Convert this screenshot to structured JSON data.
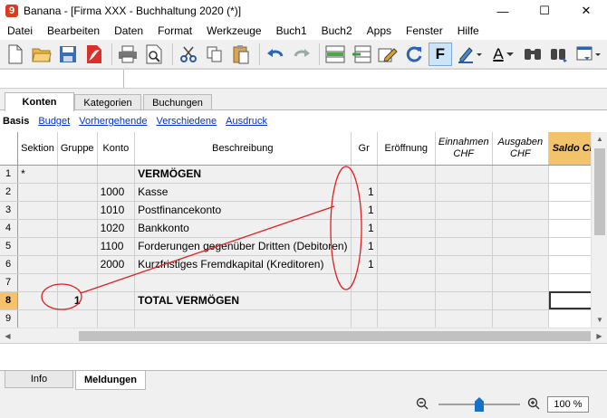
{
  "window": {
    "title": "Banana - [Firma XXX - Buchhaltung 2020 (*)]",
    "logo_text": "9",
    "minimize": "—",
    "maximize": "☐",
    "close": "✕"
  },
  "menu": [
    "Datei",
    "Bearbeiten",
    "Daten",
    "Format",
    "Werkzeuge",
    "Buch1",
    "Buch2",
    "Apps",
    "Fenster",
    "Hilfe"
  ],
  "toolbar": {
    "bold_label": "F",
    "font_color_label": "A"
  },
  "tabs": [
    "Konten",
    "Kategorien",
    "Buchungen"
  ],
  "active_tab": "Konten",
  "views": {
    "current": "Basis",
    "links": [
      "Budget",
      "Vorhergehende",
      "Verschiedene",
      "Ausdruck"
    ]
  },
  "table": {
    "headers": {
      "sektion": "Sektion",
      "gruppe": "Gruppe",
      "konto": "Konto",
      "beschreibung": "Beschreibung",
      "gr": "Gr",
      "eroeffnung": "Eröffnung",
      "einnahmen": "Einnahmen CHF",
      "ausgaben": "Ausgaben CHF",
      "saldo": "Saldo CHF"
    },
    "rows": [
      {
        "n": "1",
        "sektion": "*",
        "gruppe": "",
        "konto": "",
        "beschreibung": "VERMÖGEN",
        "gr": "",
        "bold": true
      },
      {
        "n": "2",
        "sektion": "",
        "gruppe": "",
        "konto": "1000",
        "beschreibung": "Kasse",
        "gr": "1",
        "bold": false
      },
      {
        "n": "3",
        "sektion": "",
        "gruppe": "",
        "konto": "1010",
        "beschreibung": "Postfinancekonto",
        "gr": "1",
        "bold": false
      },
      {
        "n": "4",
        "sektion": "",
        "gruppe": "",
        "konto": "1020",
        "beschreibung": "Bankkonto",
        "gr": "1",
        "bold": false
      },
      {
        "n": "5",
        "sektion": "",
        "gruppe": "",
        "konto": "1100",
        "beschreibung": "Forderungen gegenüber Dritten (Debitoren)",
        "gr": "1",
        "bold": false
      },
      {
        "n": "6",
        "sektion": "",
        "gruppe": "",
        "konto": "2000",
        "beschreibung": "Kurzfristiges Fremdkapital (Kreditoren)",
        "gr": "1",
        "bold": false
      },
      {
        "n": "7",
        "sektion": "",
        "gruppe": "",
        "konto": "",
        "beschreibung": "",
        "gr": "",
        "bold": false
      },
      {
        "n": "8",
        "sektion": "",
        "gruppe": "1",
        "konto": "",
        "beschreibung": "TOTAL VERMÖGEN",
        "gr": "",
        "bold": true
      },
      {
        "n": "9",
        "sektion": "",
        "gruppe": "",
        "konto": "",
        "beschreibung": "",
        "gr": "",
        "bold": false
      }
    ],
    "selected_row": "8"
  },
  "bottom_tabs": [
    "Info",
    "Meldungen"
  ],
  "active_bottom_tab": "Meldungen",
  "zoom": {
    "value": "100 %",
    "level_fraction": 0.5
  },
  "colors": {
    "saldo_header": "#f2c36b",
    "selected_row": "#f8c26c",
    "annotation": "#e02020",
    "link": "#0033cc"
  }
}
